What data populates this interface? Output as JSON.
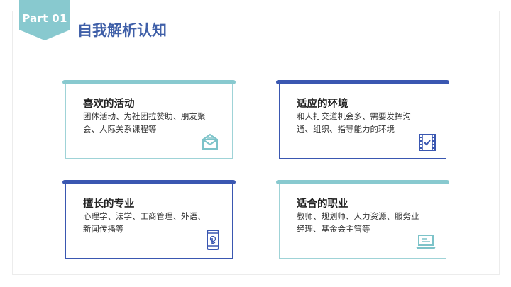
{
  "header": {
    "part_label": "Part 01",
    "title": "自我解析认知"
  },
  "colors": {
    "teal": "#88c9cf",
    "navy": "#3a57b1",
    "title_blue": "#3f5fa8"
  },
  "cards": [
    {
      "title": "喜欢的活动",
      "description": "团体活动、为社团拉赞助、朋友聚会、人际关系课程等",
      "icon": "envelope-icon",
      "accent": "#88c9cf"
    },
    {
      "title": "适应的环境",
      "description": "和人打交道机会多、需要发挥沟通、组织、指导能力的环境",
      "icon": "film-check-icon",
      "accent": "#3a57b1"
    },
    {
      "title": "擅长的专业",
      "description": "心理学、法学、工商管理、外语、新闻传播等",
      "icon": "touch-phone-icon",
      "accent": "#3a57b1"
    },
    {
      "title": "适合的职业",
      "description": "教师、规划师、人力资源、服务业经理、基金会主管等",
      "icon": "laptop-icon",
      "accent": "#88c9cf"
    }
  ]
}
